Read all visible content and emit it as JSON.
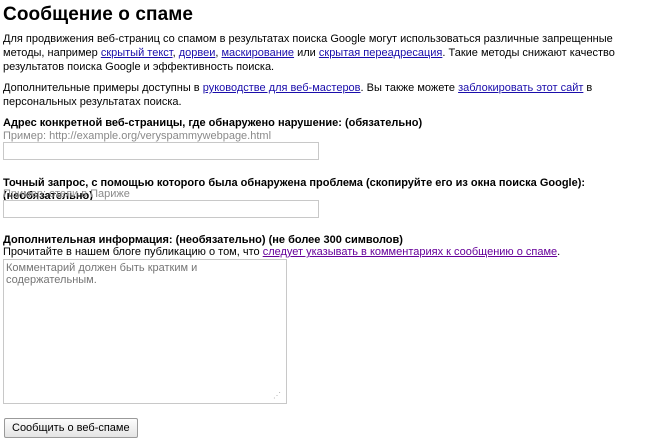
{
  "title": "Сообщение о спаме",
  "intro": {
    "t1": "Для продвижения веб-страниц со спамом в результатах поиска Google могут использоваться различные запрещенные методы, например ",
    "link1": "скрытый текст",
    "t2": ", ",
    "link2": "дорвеи",
    "t3": ", ",
    "link3": "маскирование",
    "t4": " или ",
    "link4": "скрытая переадресация",
    "t5": ". Такие методы снижают качество результатов поиска Google и эффективность поиска."
  },
  "more": {
    "t1": "Дополнительные примеры доступны в ",
    "link1": "руководстве для веб-мастеров",
    "t2": ". Вы также можете ",
    "link2": "заблокировать этот сайт",
    "t3": " в персональных результатах поиска."
  },
  "url_field": {
    "label": "Адрес конкретной веб-страницы, где обнаружено нарушение: (обязательно)",
    "hint": "Пример: http://example.org/veryspammywebpage.html",
    "value": ""
  },
  "query_field": {
    "label": "Точный запрос, с помощью которого была обнаружена проблема (скопируйте его из окна поиска Google): (необязательно)",
    "hint": "Пример: отели в Париже",
    "value": ""
  },
  "info_field": {
    "label": "Дополнительная информация: (необязательно) (не более 300 символов)",
    "hint_t1": "Прочитайте в нашем блоге публикацию о том, что ",
    "hint_link": "следует указывать в комментариях к сообщению о спаме",
    "hint_t2": ".",
    "placeholder": "Комментарий должен быть кратким и содержательным."
  },
  "submit_label": "Сообщить о веб-спаме",
  "colors": {
    "link": "#1a0dab",
    "visited_link": "#660099",
    "hint": "#8a8a8a"
  }
}
